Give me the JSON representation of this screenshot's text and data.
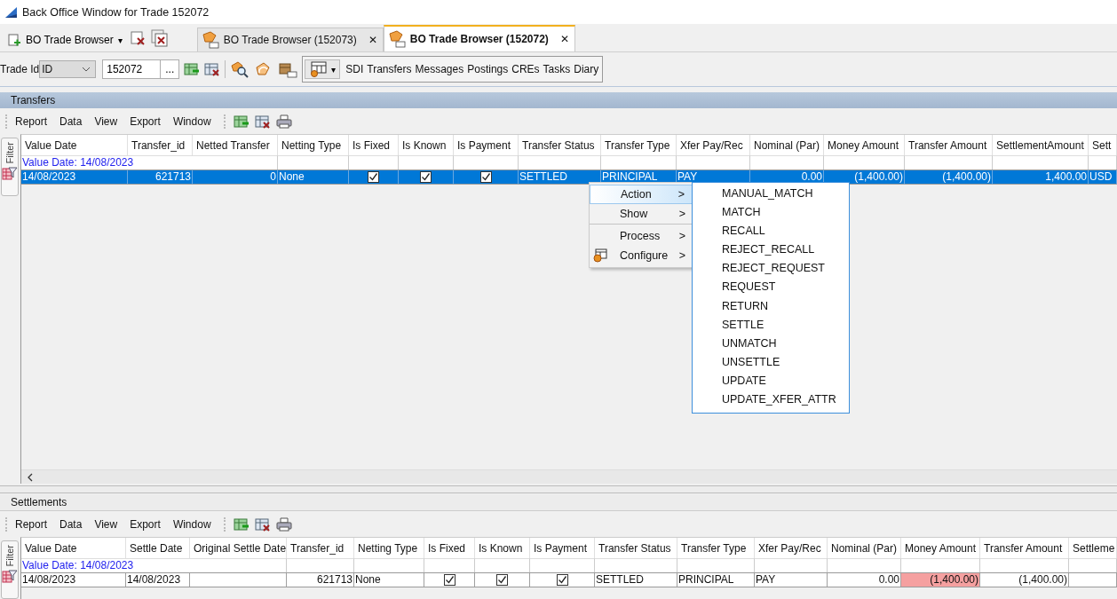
{
  "window": {
    "title": "Back Office Window for Trade 152072"
  },
  "launcher": {
    "label": "BO Trade Browser",
    "caret": "▾"
  },
  "tabs": [
    {
      "label": "BO Trade Browser (152073)",
      "selected": false,
      "close": "✕"
    },
    {
      "label": "BO Trade Browser (152072)",
      "selected": true,
      "close": "✕"
    }
  ],
  "trade_toolbar": {
    "label": "Trade Id",
    "type_select": "ID",
    "trade_id": "152072",
    "browse": "...",
    "caret": "▾",
    "links": [
      "SDI",
      "Transfers",
      "Messages",
      "Postings",
      "CREs",
      "Tasks",
      "Diary"
    ]
  },
  "transfers": {
    "title": "Transfers",
    "filter_tab": "Filter",
    "menu": [
      "Report",
      "Data",
      "View",
      "Export",
      "Window"
    ],
    "columns": [
      {
        "label": "Value Date",
        "kind": "text"
      },
      {
        "label": "Transfer_id",
        "kind": "number"
      },
      {
        "label": "Netted Transfer",
        "kind": "number"
      },
      {
        "label": "Netting Type",
        "kind": "text"
      },
      {
        "label": "Is Fixed",
        "kind": "check"
      },
      {
        "label": "Is Known",
        "kind": "check"
      },
      {
        "label": "Is Payment",
        "kind": "check"
      },
      {
        "label": "Transfer Status",
        "kind": "text"
      },
      {
        "label": "Transfer Type",
        "kind": "text"
      },
      {
        "label": "Xfer Pay/Rec",
        "kind": "text"
      },
      {
        "label": "Nominal (Par)",
        "kind": "number"
      },
      {
        "label": "Money Amount",
        "kind": "number"
      },
      {
        "label": "Transfer Amount",
        "kind": "number"
      },
      {
        "label": "SettlementAmount",
        "kind": "number"
      },
      {
        "label": "Sett",
        "kind": "text"
      }
    ],
    "group_label": "Value Date: 14/08/2023",
    "rows": [
      {
        "selected": true,
        "cells": [
          {
            "text": "14/08/2023"
          },
          {
            "text": "621713"
          },
          {
            "text": "0"
          },
          {
            "text": "None"
          },
          {
            "checked": true
          },
          {
            "checked": true
          },
          {
            "checked": true
          },
          {
            "text": "SETTLED"
          },
          {
            "text": "PRINCIPAL"
          },
          {
            "text": "PAY"
          },
          {
            "text": "0.00"
          },
          {
            "text": "(1,400.00)"
          },
          {
            "text": "(1,400.00)"
          },
          {
            "text": "1,400.00"
          },
          {
            "text": "USD"
          }
        ]
      }
    ]
  },
  "context_menu": {
    "items": [
      {
        "label": "Action",
        "selected": true,
        "has_icon": false,
        "separator_after": false,
        "arrow": ">"
      },
      {
        "label": "Show",
        "selected": false,
        "has_icon": false,
        "separator_after": true,
        "arrow": ">"
      },
      {
        "label": "Process",
        "selected": false,
        "has_icon": false,
        "separator_after": false,
        "arrow": ">"
      },
      {
        "label": "Configure",
        "selected": false,
        "has_icon": true,
        "separator_after": false,
        "arrow": ">"
      }
    ],
    "submenu": [
      "MANUAL_MATCH",
      "MATCH",
      "RECALL",
      "REJECT_RECALL",
      "REJECT_REQUEST",
      "REQUEST",
      "RETURN",
      "SETTLE",
      "UNMATCH",
      "UNSETTLE",
      "UPDATE",
      "UPDATE_XFER_ATTR"
    ]
  },
  "settlements": {
    "title": "Settlements",
    "filter_tab": "Filter",
    "menu": [
      "Report",
      "Data",
      "View",
      "Export",
      "Window"
    ],
    "columns": [
      {
        "label": "Value Date",
        "kind": "text"
      },
      {
        "label": "Settle Date",
        "kind": "text"
      },
      {
        "label": "Original Settle Date",
        "kind": "text"
      },
      {
        "label": "Transfer_id",
        "kind": "number"
      },
      {
        "label": "Netting Type",
        "kind": "text"
      },
      {
        "label": "Is Fixed",
        "kind": "check"
      },
      {
        "label": "Is Known",
        "kind": "check"
      },
      {
        "label": "Is Payment",
        "kind": "check"
      },
      {
        "label": "Transfer Status",
        "kind": "text"
      },
      {
        "label": "Transfer Type",
        "kind": "text"
      },
      {
        "label": "Xfer Pay/Rec",
        "kind": "text"
      },
      {
        "label": "Nominal (Par)",
        "kind": "number"
      },
      {
        "label": "Money Amount",
        "kind": "number"
      },
      {
        "label": "Transfer Amount",
        "kind": "number"
      },
      {
        "label": "Settleme",
        "kind": "text"
      }
    ],
    "group_label": "Value Date: 14/08/2023",
    "rows": [
      {
        "selected": false,
        "cells": [
          {
            "text": "14/08/2023"
          },
          {
            "text": "14/08/2023"
          },
          {
            "text": ""
          },
          {
            "text": "621713"
          },
          {
            "text": "None"
          },
          {
            "checked": true
          },
          {
            "checked": true
          },
          {
            "checked": true
          },
          {
            "text": "SETTLED"
          },
          {
            "text": "PRINCIPAL"
          },
          {
            "text": "PAY"
          },
          {
            "text": "0.00"
          },
          {
            "text": "(1,400.00)",
            "highlight": true
          },
          {
            "text": "(1,400.00)"
          },
          {
            "text": ""
          }
        ]
      }
    ]
  }
}
